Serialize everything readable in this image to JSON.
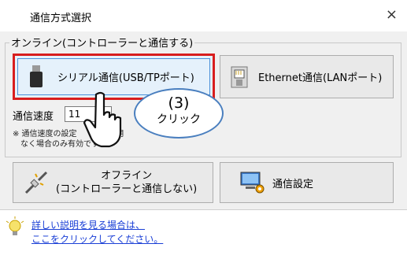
{
  "dialog": {
    "title": "通信方式選択",
    "close": "×"
  },
  "online": {
    "group_label": "オンライン(コントローラーと通信する)",
    "usb_button": "シリアル通信(USB/TPポート)",
    "ethernet_button": "Ethernet通信(LANポート)",
    "speed_label": "通信速度",
    "speed_value": "11",
    "note_line1": "※ 通信速度の設定　　　　専用",
    "note_line2": "　なく場合のみ有効です。"
  },
  "bottom_buttons": {
    "offline_line1": "オフライン",
    "offline_line2": "(コントローラーと通信しない)",
    "settings": "通信設定"
  },
  "help": {
    "line1": "詳しい説明を見る場合は、",
    "line2": "ここをクリックしてください。"
  },
  "callout": {
    "number": "(3)",
    "text": "クリック"
  },
  "icons": {
    "usb": "usb-plug-icon",
    "ethernet": "ethernet-port-icon",
    "offline": "unplugged-icon",
    "settings": "computer-settings-icon",
    "help": "lightbulb-icon",
    "cursor": "hand-pointer-icon"
  },
  "colors": {
    "highlight_border": "#d81e1e",
    "link": "#1a3fd6",
    "callout_border": "#4a7fbf"
  }
}
